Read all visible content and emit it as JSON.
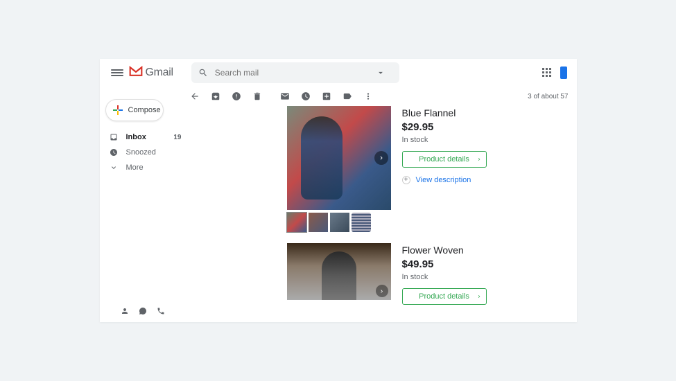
{
  "app": {
    "name": "Gmail"
  },
  "search": {
    "placeholder": "Search mail"
  },
  "compose": {
    "label": "Compose"
  },
  "sidebar": {
    "items": [
      {
        "label": "Inbox",
        "count": "19"
      },
      {
        "label": "Snoozed"
      },
      {
        "label": "More"
      }
    ]
  },
  "pagination": {
    "text": "3 of about 57"
  },
  "products": [
    {
      "title": "Blue Flannel",
      "price": "$29.95",
      "stock": "In stock",
      "button": "Product details",
      "view_desc": "View description"
    },
    {
      "title": "Flower Woven",
      "price": "$49.95",
      "stock": "In stock",
      "button": "Product details"
    }
  ]
}
